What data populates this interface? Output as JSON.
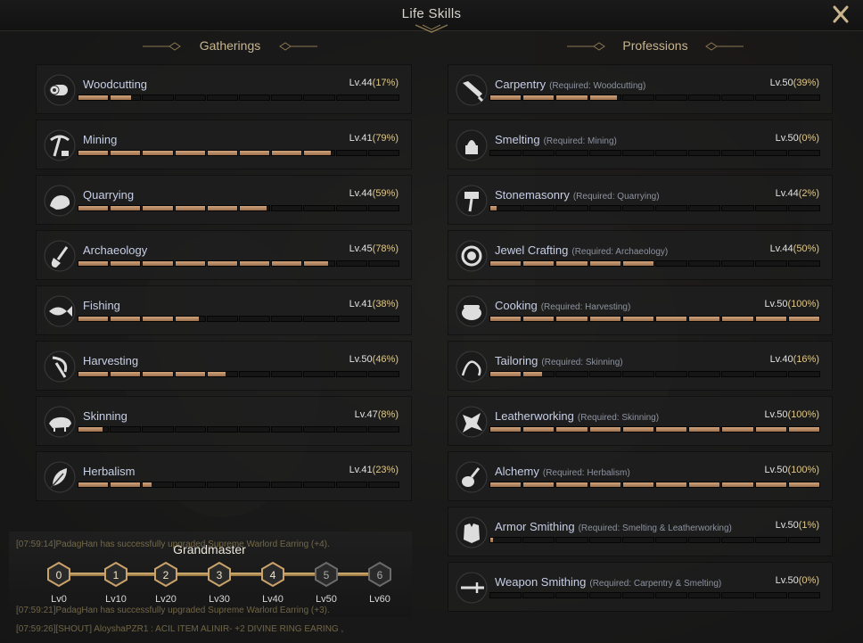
{
  "window": {
    "title": "Life Skills"
  },
  "gatherings": {
    "header": "Gatherings",
    "skills": [
      {
        "name": "Woodcutting",
        "level": "Lv.44",
        "percent": "(17%)",
        "progress": 0.17,
        "icon": "log-icon"
      },
      {
        "name": "Mining",
        "level": "Lv.41",
        "percent": "(79%)",
        "progress": 0.79,
        "icon": "pickaxe-icon"
      },
      {
        "name": "Quarrying",
        "level": "Lv.44",
        "percent": "(59%)",
        "progress": 0.59,
        "icon": "stone-icon"
      },
      {
        "name": "Archaeology",
        "level": "Lv.45",
        "percent": "(78%)",
        "progress": 0.78,
        "icon": "shovel-icon"
      },
      {
        "name": "Fishing",
        "level": "Lv.41",
        "percent": "(38%)",
        "progress": 0.38,
        "icon": "fish-icon"
      },
      {
        "name": "Harvesting",
        "level": "Lv.50",
        "percent": "(46%)",
        "progress": 0.46,
        "icon": "sickle-icon"
      },
      {
        "name": "Skinning",
        "level": "Lv.47",
        "percent": "(8%)",
        "progress": 0.08,
        "icon": "boar-icon"
      },
      {
        "name": "Herbalism",
        "level": "Lv.41",
        "percent": "(23%)",
        "progress": 0.23,
        "icon": "leaf-icon"
      }
    ]
  },
  "professions": {
    "header": "Professions",
    "skills": [
      {
        "name": "Carpentry",
        "req": "(Required: Woodcutting)",
        "level": "Lv.50",
        "percent": "(39%)",
        "progress": 0.39,
        "icon": "saw-icon"
      },
      {
        "name": "Smelting",
        "req": "(Required: Mining)",
        "level": "Lv.50",
        "percent": "(0%)",
        "progress": 0.0,
        "icon": "furnace-icon"
      },
      {
        "name": "Stonemasonry",
        "req": "(Required: Quarrying)",
        "level": "Lv.44",
        "percent": "(2%)",
        "progress": 0.02,
        "icon": "hammer-icon"
      },
      {
        "name": "Jewel Crafting",
        "req": "(Required: Archaeology)",
        "level": "Lv.44",
        "percent": "(50%)",
        "progress": 0.5,
        "icon": "gem-icon"
      },
      {
        "name": "Cooking",
        "req": "(Required: Harvesting)",
        "level": "Lv.50",
        "percent": "(100%)",
        "progress": 1.0,
        "icon": "pot-icon"
      },
      {
        "name": "Tailoring",
        "req": "(Required: Skinning)",
        "level": "Lv.40",
        "percent": "(16%)",
        "progress": 0.16,
        "icon": "needle-icon"
      },
      {
        "name": "Leatherworking",
        "req": "(Required: Skinning)",
        "level": "Lv.50",
        "percent": "(100%)",
        "progress": 1.0,
        "icon": "leather-icon"
      },
      {
        "name": "Alchemy",
        "req": "(Required: Herbalism)",
        "level": "Lv.50",
        "percent": "(100%)",
        "progress": 1.0,
        "icon": "flask-icon"
      },
      {
        "name": "Armor Smithing",
        "req": "(Required: Smelting & Leatherworking)",
        "level": "Lv.50",
        "percent": "(1%)",
        "progress": 0.01,
        "icon": "armor-icon"
      },
      {
        "name": "Weapon Smithing",
        "req": "(Required: Carpentry & Smelting)",
        "level": "Lv.50",
        "percent": "(0%)",
        "progress": 0.0,
        "icon": "sword-icon"
      }
    ]
  },
  "grandmaster": {
    "title": "Grandmaster",
    "tiers": [
      {
        "num": "0",
        "label": "Lv0",
        "reached": true
      },
      {
        "num": "1",
        "label": "Lv10",
        "reached": true
      },
      {
        "num": "2",
        "label": "Lv20",
        "reached": true
      },
      {
        "num": "3",
        "label": "Lv30",
        "reached": true
      },
      {
        "num": "4",
        "label": "Lv40",
        "reached": true
      },
      {
        "num": "5",
        "label": "Lv50",
        "reached": false
      },
      {
        "num": "6",
        "label": "Lv60",
        "reached": false
      }
    ]
  },
  "background_chat": [
    "[07:59:14]PadagHan has successfully upgraded Supreme Warlord Earring (+4).",
    "[07:59:21]PadagHan has successfully upgraded Supreme Warlord Earring (+3).",
    "[07:59:26][SHOUT] AloyshaPZR1 : ACIL ITEM ALINIR- +2 DIVINE RING EARING ,"
  ],
  "colors": {
    "bar_fill": "#c79c75",
    "accent": "#e0c98c",
    "name": "#c7cfe6"
  }
}
